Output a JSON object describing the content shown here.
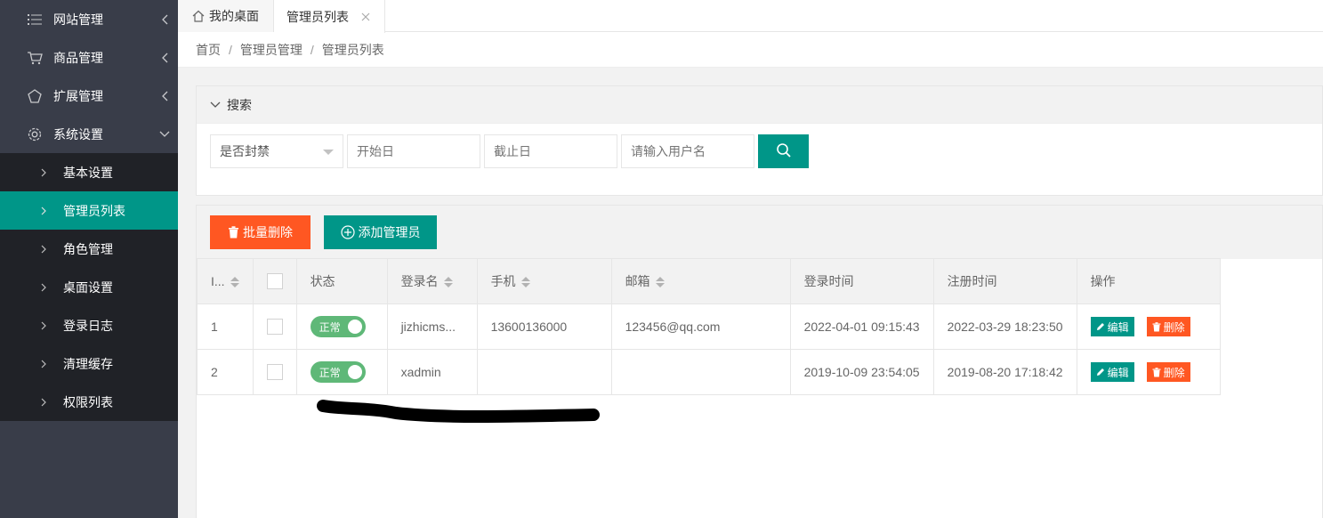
{
  "sidebar": {
    "menus": [
      {
        "label": "网站管理",
        "icon": "list-icon"
      },
      {
        "label": "商品管理",
        "icon": "cart-icon"
      },
      {
        "label": "扩展管理",
        "icon": "extension-icon"
      },
      {
        "label": "系统设置",
        "icon": "gear-icon"
      }
    ],
    "sub_items": [
      {
        "label": "基本设置"
      },
      {
        "label": "管理员列表"
      },
      {
        "label": "角色管理"
      },
      {
        "label": "桌面设置"
      },
      {
        "label": "登录日志"
      },
      {
        "label": "清理缓存"
      },
      {
        "label": "权限列表"
      }
    ]
  },
  "tabs": {
    "home": "我的桌面",
    "active": "管理员列表"
  },
  "breadcrumb": [
    "首页",
    "管理员管理",
    "管理员列表"
  ],
  "search": {
    "header": "搜索",
    "status_select": "是否封禁",
    "start_date_placeholder": "开始日",
    "end_date_placeholder": "截止日",
    "username_placeholder": "请输入用户名"
  },
  "toolbar": {
    "batch_delete": "批量删除",
    "add_admin": "添加管理员"
  },
  "table": {
    "headers": {
      "id": "I...",
      "status": "状态",
      "login_name": "登录名",
      "phone": "手机",
      "email": "邮箱",
      "login_time": "登录时间",
      "register_time": "注册时间",
      "actions": "操作"
    },
    "rows": [
      {
        "id": "1",
        "status": "正常",
        "login_name": "jizhicms...",
        "phone": "13600136000",
        "email": "123456@qq.com",
        "login_time": "2022-04-01 09:15:43",
        "register_time": "2022-03-29 18:23:50",
        "edit": "编辑",
        "delete": "删除"
      },
      {
        "id": "2",
        "status": "正常",
        "login_name": "xadmin",
        "phone": "",
        "email": "",
        "login_time": "2019-10-09 23:54:05",
        "register_time": "2019-08-20 17:18:42",
        "edit": "编辑",
        "delete": "删除"
      }
    ]
  },
  "colors": {
    "sidebar_bg": "#393d49",
    "subnav_bg": "#202227",
    "accent": "#009688",
    "danger": "#ff5722",
    "switch_on": "#5fb878"
  }
}
